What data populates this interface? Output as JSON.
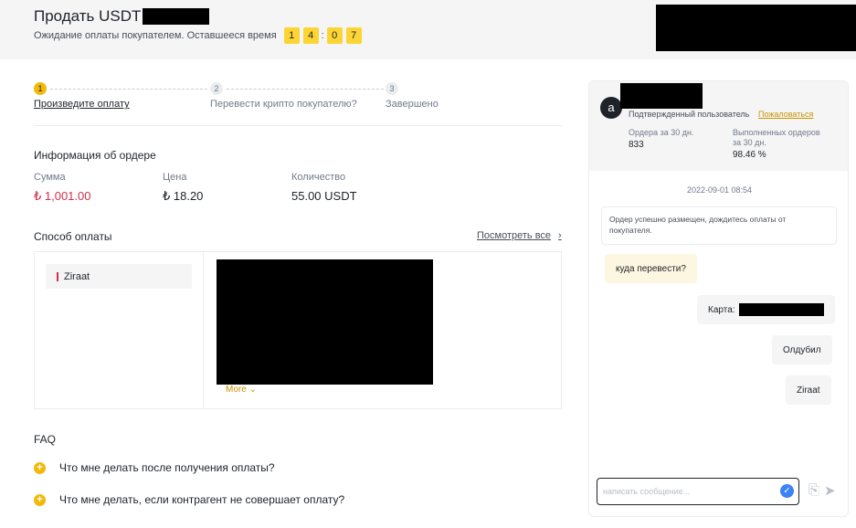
{
  "header": {
    "title": "Продать USDT",
    "waiting_text": "Ожидание оплаты покупателем. Оставшееся время",
    "timer_digits": [
      "1",
      "4",
      "0",
      "7"
    ],
    "timer_separator": ":"
  },
  "steps": [
    {
      "num": "1",
      "label": "Произведите оплату",
      "active": true
    },
    {
      "num": "2",
      "label": "Перевести крипто покупателю?",
      "active": false
    },
    {
      "num": "3",
      "label": "Завершено",
      "active": false
    }
  ],
  "order": {
    "title": "Информация об ордере",
    "fields": [
      {
        "label": "Сумма",
        "value": "₺ 1,001.00"
      },
      {
        "label": "Цена",
        "value": "₺ 18.20"
      },
      {
        "label": "Количество",
        "value": "55.00 USDT"
      }
    ]
  },
  "payment": {
    "title": "Способ оплаты",
    "view_all": "Посмотреть все",
    "method": "Ziraat",
    "more": "More"
  },
  "faq": {
    "title": "FAQ",
    "items": [
      "Что мне делать после получения оплаты?",
      "Что мне делать, если контрагент не совершает оплату?"
    ]
  },
  "chat": {
    "avatar_letter": "a",
    "verified": "Подтвержденный пользователь",
    "complain": "Пожаловаться",
    "orders_label": "Ордера за 30 дн.",
    "orders_value": "833",
    "completed_label_1": "Выполненных ордеров",
    "completed_label_2": "за 30 дн.",
    "completed_value": "98.46 %",
    "timestamp": "2022-09-01 08:54",
    "system_message": "Ордер успешно размещен, дождитесь оплаты от покупателя.",
    "messages": [
      {
        "text": "куда перевести?",
        "side": "in"
      },
      {
        "text": "Карта:",
        "side": "out"
      },
      {
        "text": "Олдубил",
        "side": "out"
      },
      {
        "text": "Ziraat",
        "side": "out"
      }
    ],
    "input_placeholder": "написать сообщение..."
  },
  "colors": {
    "accent": "#f0b90b",
    "timer_bg": "#fcd535",
    "amount_red": "#cf304a",
    "link_gold": "#c99400"
  }
}
